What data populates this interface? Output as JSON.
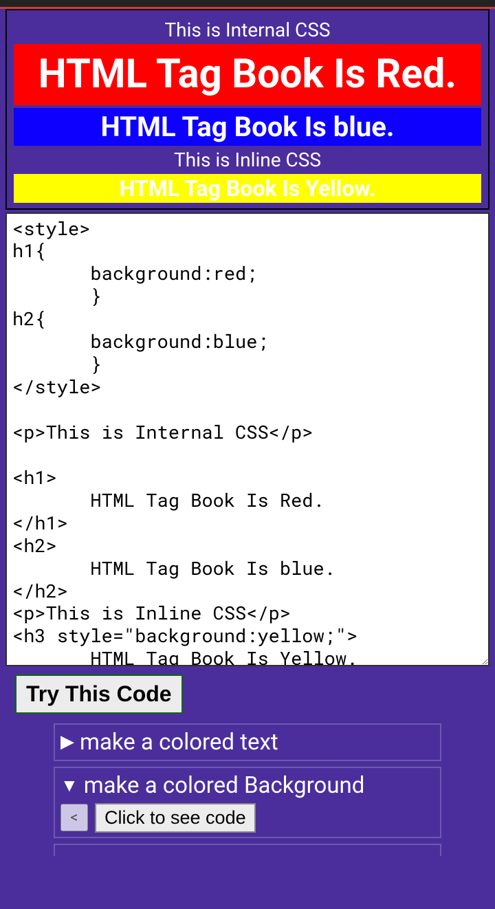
{
  "preview": {
    "internal_label": "This is Internal CSS",
    "h1": "HTML Tag Book Is Red.",
    "h2": "HTML Tag Book Is blue.",
    "inline_label": "This is Inline CSS",
    "h3": "HTML Tag Book Is Yellow."
  },
  "code": "<style>\nh1{\n       background:red;\n       }\nh2{\n       background:blue;\n       }\n</style>\n\n<p>This is Internal CSS</p>\n\n<h1>\n       HTML Tag Book Is Red.\n</h1>\n<h2>\n       HTML Tag Book Is blue.\n</h2>\n<p>This is Inline CSS</p>\n<h3 style=\"background:yellow;\">\n       HTML Tag Book Is Yellow.",
  "try_button": "Try This Code",
  "accordions": {
    "item0": {
      "label": "make a colored text",
      "tri": "▶"
    },
    "item1": {
      "label": "make a colored Background",
      "tri": "▼",
      "back": "<",
      "see": "Click to see code"
    }
  }
}
